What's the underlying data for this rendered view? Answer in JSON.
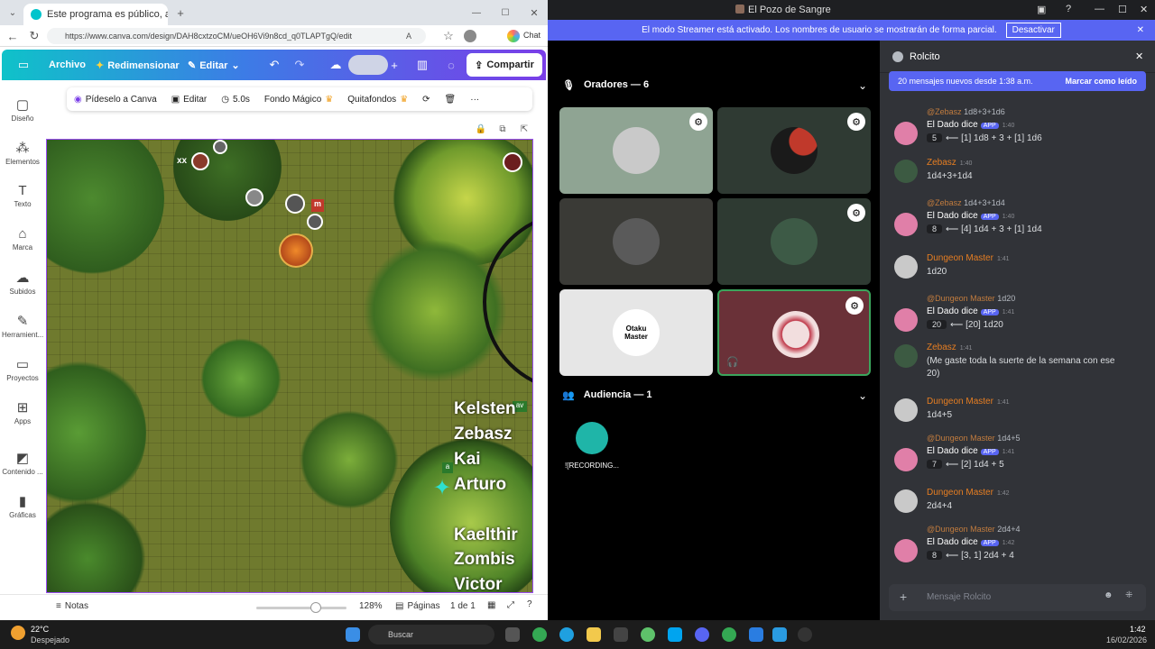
{
  "browser": {
    "tab_title": "Este programa es público, ajeno a",
    "url": "https://www.canva.com/design/DAH8cxtzoCM/ueOH6Vi9n8cd_q0TLAPTgQ/edit",
    "chat_label": "Chat"
  },
  "canva": {
    "menu": {
      "file": "Archivo",
      "resize": "Redimensionar",
      "edit": "Editar",
      "share": "Compartir"
    },
    "toolbar": {
      "ask": "Pídeselo a Canva",
      "edit": "Editar",
      "duration": "5.0s",
      "magic_bg": "Fondo Mágico",
      "bg_remover": "Quitafondos"
    },
    "rail": [
      "Diseño",
      "Elementos",
      "Texto",
      "Marca",
      "Subidos",
      "Herramient...",
      "Proyectos",
      "Apps",
      "Contenido ...",
      "Gráficas"
    ],
    "footer": {
      "notes": "Notas",
      "zoom": "128%",
      "pages_label": "Páginas",
      "pages": "1 de 1"
    },
    "map_labels": [
      "Kelsten",
      "Zebasz",
      "Kai",
      "Arturo",
      "Kaelthir",
      "Zombis",
      "Victor"
    ],
    "token_tags": [
      "xx",
      "m",
      "av",
      "a"
    ]
  },
  "discord": {
    "window_title": "El Pozo de Sangre",
    "streamer_notice": "El modo Streamer está activado. Los nombres de usuario se mostrarán de forma parcial.",
    "streamer_button": "Desactivar",
    "speakers_header": "Oradores — 6",
    "audience_header": "Audiencia — 1",
    "audience_member": "![RECORDING...",
    "dm_tile_text": "Otaku Master",
    "chat": {
      "channel": "Rolcito",
      "new_messages": "20 mensajes nuevos desde 1:38 a.m.",
      "mark_read": "Marcar como leído",
      "input_placeholder": "Mensaje Rolcito",
      "messages": [
        {
          "reply_user": "@Zebasz",
          "reply_text": "1d8+3+1d6",
          "user": "El Dado dice",
          "app": "APP",
          "time": "1:40",
          "dice_total": "5",
          "text": "⟵ [1] 1d8 + 3 + [1] 1d6",
          "color": "#ffffff"
        },
        {
          "user": "Zebasz",
          "time": "1:40",
          "text": "1d4+3+1d4",
          "color": "#e67e22"
        },
        {
          "reply_user": "@Zebasz",
          "reply_text": "1d4+3+1d4",
          "user": "El Dado dice",
          "app": "APP",
          "time": "1:40",
          "dice_total": "8",
          "text": "⟵ [4] 1d4 + 3 + [1] 1d4",
          "color": "#ffffff"
        },
        {
          "user": "Dungeon Master",
          "time": "1:41",
          "text": "1d20",
          "color": "#e67e22"
        },
        {
          "reply_user": "@Dungeon Master",
          "reply_text": "1d20",
          "user": "El Dado dice",
          "app": "APP",
          "time": "1:41",
          "dice_total": "20",
          "text": "⟵ [20] 1d20",
          "color": "#ffffff"
        },
        {
          "user": "Zebasz",
          "time": "1:41",
          "text": "(Me gaste toda la suerte de la semana con ese",
          "text2": "20)",
          "color": "#e67e22"
        },
        {
          "user": "Dungeon Master",
          "time": "1:41",
          "text": "1d4+5",
          "color": "#e67e22"
        },
        {
          "reply_user": "@Dungeon Master",
          "reply_text": "1d4+5",
          "user": "El Dado dice",
          "app": "APP",
          "time": "1:41",
          "dice_total": "7",
          "text": "⟵ [2] 1d4 + 5",
          "color": "#ffffff"
        },
        {
          "user": "Dungeon Master",
          "time": "1:42",
          "text": "2d4+4",
          "color": "#e67e22"
        },
        {
          "reply_user": "@Dungeon Master",
          "reply_text": "2d4+4",
          "user": "El Dado dice",
          "app": "APP",
          "time": "1:42",
          "dice_total": "8",
          "text": "⟵ [3, 1] 2d4 + 4",
          "color": "#ffffff"
        }
      ]
    }
  },
  "taskbar": {
    "weather_temp": "22°C",
    "weather_desc": "Despejado",
    "search_placeholder": "Buscar",
    "time": "1:42",
    "date": "16/02/2026"
  }
}
